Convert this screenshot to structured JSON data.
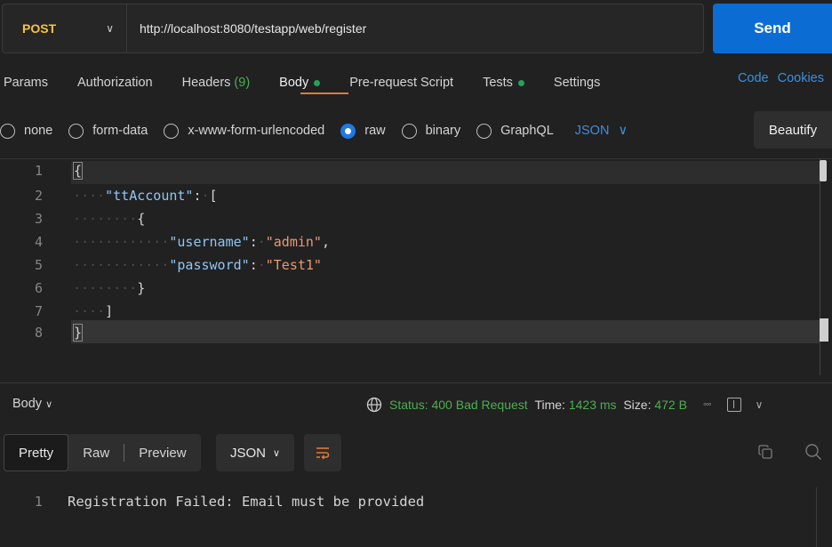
{
  "request": {
    "method": "POST",
    "url": "http://localhost:8080/testapp/web/register",
    "send_label": "Send"
  },
  "tabs": [
    {
      "label": "Params"
    },
    {
      "label": "Authorization"
    },
    {
      "label": "Headers",
      "count": "(9)"
    },
    {
      "label": "Body"
    },
    {
      "label": "Pre-request Script"
    },
    {
      "label": "Tests"
    },
    {
      "label": "Settings"
    }
  ],
  "tab_links": {
    "code": "Code",
    "cookies": "Cookies"
  },
  "body_types": [
    "none",
    "form-data",
    "x-www-form-urlencoded",
    "raw",
    "binary",
    "GraphQL"
  ],
  "body_type_selected": "raw",
  "body_format": "JSON",
  "beautify_label": "Beautify",
  "editor": {
    "line_numbers": [
      "1",
      "2",
      "3",
      "4",
      "5",
      "6",
      "7",
      "8"
    ],
    "key_account": "\"ttAccount\"",
    "key_username": "\"username\"",
    "val_username": "\"admin\"",
    "key_password": "\"password\"",
    "val_password": "\"Test1\""
  },
  "response": {
    "body_label": "Body",
    "status_label": "Status:",
    "status_value": "400 Bad Request",
    "time_label": "Time:",
    "time_value": "1423 ms",
    "size_label": "Size:",
    "size_value": "472 B",
    "views": [
      "Pretty",
      "Raw",
      "Preview"
    ],
    "format": "JSON",
    "line_number": "1",
    "text": "Registration Failed: Email must be provided"
  },
  "colors": {
    "accent_blue": "#0b6dd3",
    "method_yellow": "#f5c342",
    "status_green": "#4caf50",
    "tab_underline": "#e07b39"
  },
  "icons": [
    "chevron-down-icon",
    "globe-icon",
    "more-icon",
    "layout-icon",
    "wrap-icon",
    "copy-icon",
    "search-icon"
  ]
}
